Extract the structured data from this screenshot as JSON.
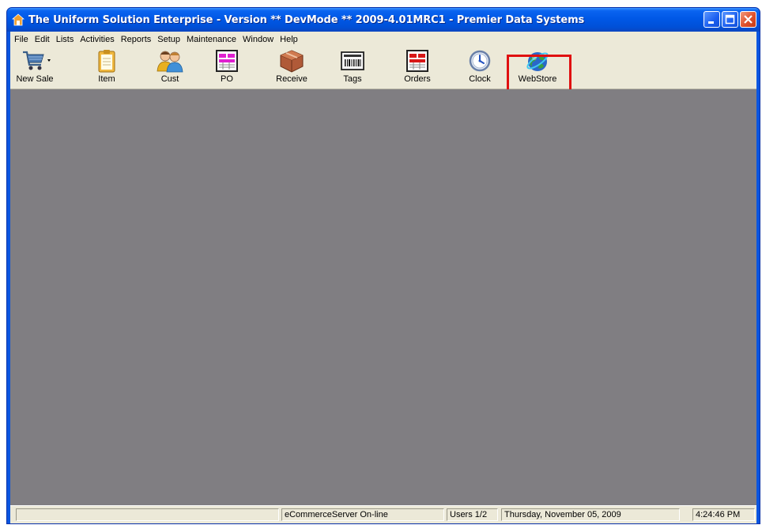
{
  "window": {
    "title": "The Uniform Solution Enterprise - Version ** DevMode ** 2009-4.01MRC1 - Premier Data Systems"
  },
  "menu": [
    "File",
    "Edit",
    "Lists",
    "Activities",
    "Reports",
    "Setup",
    "Maintenance",
    "Window",
    "Help"
  ],
  "toolbar": [
    {
      "label": "New Sale",
      "icon": "shopping-cart-icon"
    },
    {
      "label": "Item",
      "icon": "clipboard-icon"
    },
    {
      "label": "Cust",
      "icon": "people-icon"
    },
    {
      "label": "PO",
      "icon": "po-form-icon"
    },
    {
      "label": "Receive",
      "icon": "package-icon"
    },
    {
      "label": "Tags",
      "icon": "barcode-tag-icon"
    },
    {
      "label": "Orders",
      "icon": "orders-form-icon"
    },
    {
      "label": "Clock",
      "icon": "clock-icon"
    },
    {
      "label": "WebStore",
      "icon": "globe-icon"
    }
  ],
  "highlighted_tool": "WebStore",
  "highlight_color": "#e01010",
  "status": {
    "blank": "",
    "server": "eCommerceServer On-line",
    "users": "Users 1/2",
    "date": "Thursday, November 05, 2009",
    "time": "4:24:46 PM"
  },
  "colors": {
    "titlebar": "#0058e6",
    "workspace": "#807e82",
    "chrome": "#ece9d8"
  }
}
